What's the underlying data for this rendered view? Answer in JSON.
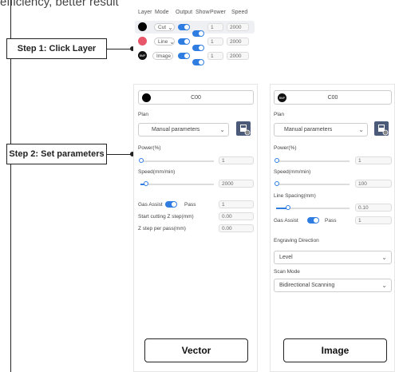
{
  "top_text": "efficiency, better result",
  "steps": {
    "step1": "Step 1:  Click Layer",
    "step2": "Step 2:  Set parameters"
  },
  "layer_table": {
    "headers": [
      "Layer",
      "Mode",
      "Output",
      "Show",
      "Power",
      "Speed"
    ],
    "rows": [
      {
        "color": "#000000",
        "mode": "Cut",
        "power": "1",
        "speed": "2000"
      },
      {
        "color": "#e8566a",
        "mode": "Line",
        "power": "1",
        "speed": "2000"
      },
      {
        "color": "#111111",
        "badge": "BMP",
        "mode": "Image",
        "power": "1",
        "speed": "2000"
      }
    ]
  },
  "vector_panel": {
    "layer_name": "C00",
    "plan_label": "Plan",
    "plan_value": "Manual parameters",
    "power_label": "Power(%)",
    "power_value": "1",
    "power_fraction": 0.0,
    "speed_label": "Speed(mm/min)",
    "speed_value": "2000",
    "speed_fraction": 0.05,
    "gas_assist_label": "Gas Assist",
    "pass_label": "Pass",
    "pass_value": "1",
    "start_z_label": "Start cutting Z step(mm)",
    "start_z_value": "0.00",
    "z_step_label": "Z step per pass(mm)",
    "z_step_value": "0.00",
    "button": "Vector"
  },
  "image_panel": {
    "badge": "BMP",
    "layer_name": "C00",
    "plan_label": "Plan",
    "plan_value": "Manual parameters",
    "power_label": "Power(%)",
    "power_value": "1",
    "power_fraction": 0.0,
    "speed_label": "Speed(mm/min)",
    "speed_value": "100",
    "speed_fraction": 0.0,
    "line_spacing_label": "Line Spacing(mm)",
    "line_spacing_value": "0.10",
    "line_spacing_fraction": 0.15,
    "gas_assist_label": "Gas Assist",
    "pass_label": "Pass",
    "pass_value": "1",
    "engraving_dir_label": "Engraving Direction",
    "engraving_dir_value": "Level",
    "scan_mode_label": "Scan Mode",
    "scan_mode_value": "Bidirectional Scanning",
    "button": "Image"
  },
  "colors": {
    "accent": "#2f7de1",
    "save_button": "#4a5a78",
    "line_color": "#e8566a"
  }
}
